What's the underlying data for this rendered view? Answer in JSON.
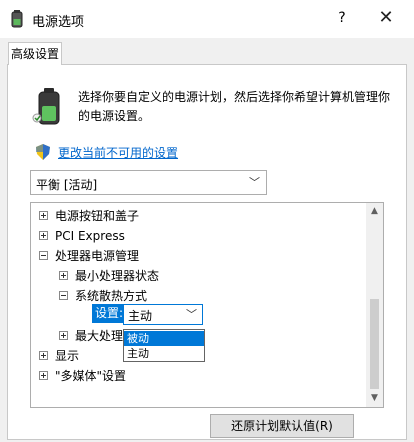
{
  "window": {
    "title": "电源选项",
    "help_glyph": "?",
    "close_glyph": "✕"
  },
  "tabs": [
    {
      "label": "高级设置"
    }
  ],
  "intro": {
    "description": "选择你要自定义的电源计划，然后选择你希望计算机管理你的电源设置。"
  },
  "link": {
    "label": "更改当前不可用的设置"
  },
  "plan_select": {
    "value": "平衡 [活动]",
    "chevron": "﹀"
  },
  "tree": {
    "items": [
      {
        "label": "电源按钮和盖子",
        "expander": "plus"
      },
      {
        "label": "PCI Express",
        "expander": "plus"
      },
      {
        "label": "处理器电源管理",
        "expander": "minus"
      },
      {
        "label": "最小处理器状态",
        "expander": "plus"
      },
      {
        "label": "系统散热方式",
        "expander": "minus"
      },
      {
        "label": "最大处理",
        "expander": "plus"
      },
      {
        "label": "显示",
        "expander": "plus"
      },
      {
        "label": "\"多媒体\"设置",
        "expander": "plus"
      }
    ],
    "setting": {
      "label": "设置:",
      "value": "主动",
      "chevron": "﹀",
      "options": [
        {
          "label": "被动",
          "highlighted": true
        },
        {
          "label": "主动",
          "highlighted": false
        }
      ]
    },
    "scroll": {
      "up_glyph": "▲",
      "down_glyph": "▼"
    }
  },
  "restore_button": {
    "label": "还原计划默认值(R)"
  },
  "colors": {
    "accent": "#0078d7",
    "link": "#0066cc",
    "window_bg": "#f0f0f0"
  }
}
